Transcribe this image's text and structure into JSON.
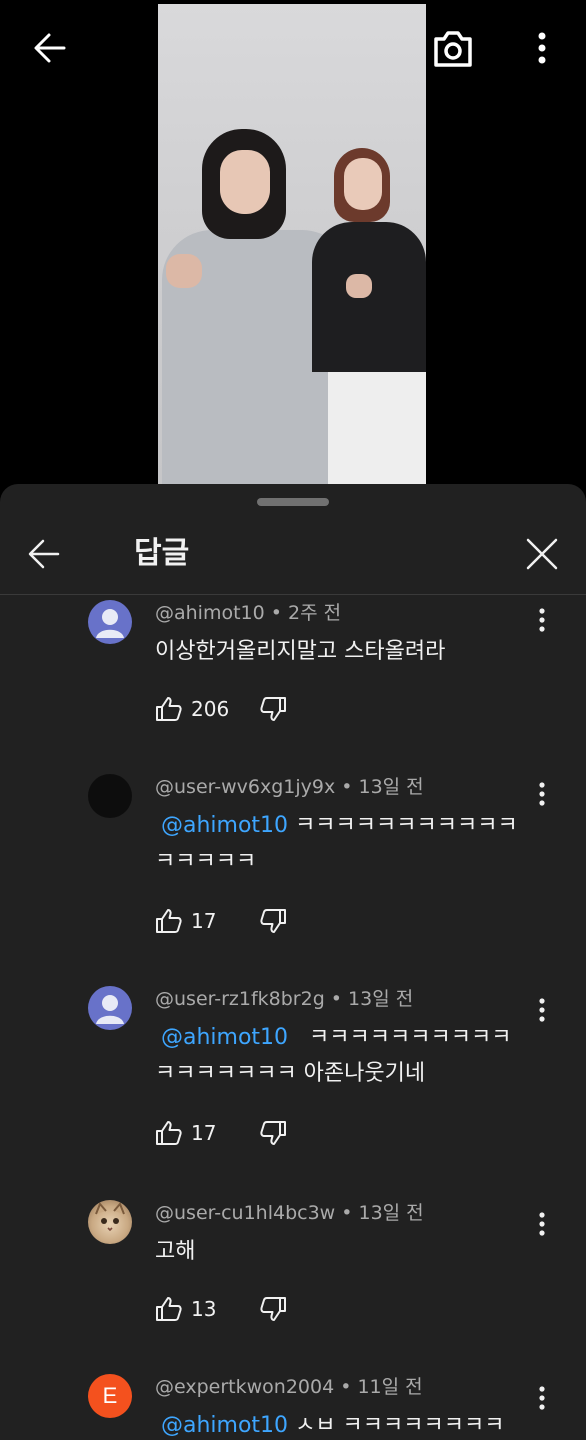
{
  "video": {
    "icons": {
      "back": "arrow-left-icon",
      "camera": "camera-icon",
      "more": "more-vertical-icon"
    }
  },
  "replies_panel": {
    "title": "답글",
    "icons": {
      "back": "arrow-left-icon",
      "close": "close-icon"
    }
  },
  "comments": [
    {
      "author": "@ahimot10",
      "time": "2주 전",
      "meta": "@ahimot10 • 2주 전",
      "avatar": "default-avatar",
      "mention": "",
      "text": "이상한거올리지말고 스타올려라",
      "likes": "206"
    },
    {
      "author": "@user-wv6xg1jy9x",
      "time": "13일 전",
      "meta": "@user-wv6xg1jy9x • 13일 전",
      "avatar": "dark-avatar",
      "mention": "@ahimot10",
      "text": "ㅋㅋㅋㅋㅋㅋㅋㅋㅋㅋㅋㅋㅋㅋㅋㅋ",
      "likes": "17"
    },
    {
      "author": "@user-rz1fk8br2g",
      "time": "13일 전",
      "meta": "@user-rz1fk8br2g • 13일 전",
      "avatar": "default-avatar",
      "mention": "@ahimot10",
      "text": "  ㅋㅋㅋㅋㅋㅋㅋㅋㅋㅋㅋㅋㅋㅋㅋㅋㅋ 아존나웃기네",
      "likes": "17"
    },
    {
      "author": "@user-cu1hl4bc3w",
      "time": "13일 전",
      "meta": "@user-cu1hl4bc3w • 13일 전",
      "avatar": "cat-avatar",
      "mention": "",
      "text": "고해",
      "likes": "13"
    },
    {
      "author": "@expertkwon2004",
      "time": "11일 전",
      "meta": "@expertkwon2004 • 11일 전",
      "avatar": "letter-avatar",
      "avatar_letter": "E",
      "mention": "@ahimot10",
      "text": "ㅅㅂ ㅋㅋㅋㅋㅋㅋㅋㅋ",
      "likes": ""
    }
  ],
  "colors": {
    "background": "#000000",
    "sheet": "#212121",
    "text": "#f1f1f1",
    "meta": "#aaaaaa",
    "mention": "#3ea6ff",
    "default_avatar": "#6872c9",
    "letter_avatar": "#f4511e"
  }
}
